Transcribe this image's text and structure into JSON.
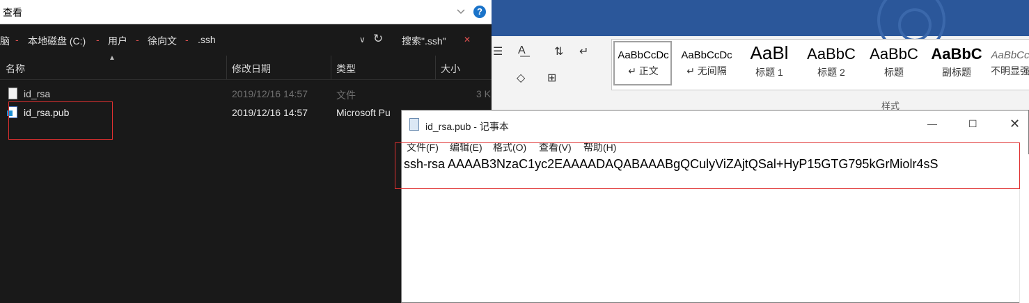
{
  "explorer": {
    "ribbon_tab": "查看",
    "address": {
      "crumbs": [
        "脑",
        "本地磁盘 (C:)",
        "用户",
        "徐向文",
        ".ssh"
      ],
      "separator": "-",
      "search_label": "搜索\".ssh\""
    },
    "columns": [
      "名称",
      "修改日期",
      "类型",
      "大小"
    ],
    "files": [
      {
        "name": "id_rsa",
        "date": "2019/12/16 14:57",
        "type": "文件",
        "size": "3 K"
      },
      {
        "name": "id_rsa.pub",
        "date": "2019/12/16 14:57",
        "type": "Microsoft Pu",
        "size": ""
      }
    ]
  },
  "word": {
    "styles": [
      {
        "preview": "AaBbCcDc",
        "name": "↵ 正文"
      },
      {
        "preview": "AaBbCcDc",
        "name": "↵ 无间隔"
      },
      {
        "preview": "AaBl",
        "name": "标题 1"
      },
      {
        "preview": "AaBbC",
        "name": "标题 2"
      },
      {
        "preview": "AaBbC",
        "name": "标题"
      },
      {
        "preview": "AaBbC",
        "name": "副标题"
      },
      {
        "preview": "AaBbCc",
        "name": "不明显强"
      }
    ],
    "group_label": "样式"
  },
  "notepad": {
    "title": "id_rsa.pub - 记事本",
    "menu": [
      "文件(F)",
      "编辑(E)",
      "格式(O)",
      "查看(V)",
      "帮助(H)"
    ],
    "content": "ssh-rsa AAAAB3NzaC1yc2EAAAADAQABAAABgQCulyViZAjtQSal+HyP15GTG795kGrMiolr4sS"
  },
  "colors": {
    "explorer_bg": "#191919",
    "word_titlebar": "#2b579a",
    "annotation_red": "#e03030"
  }
}
